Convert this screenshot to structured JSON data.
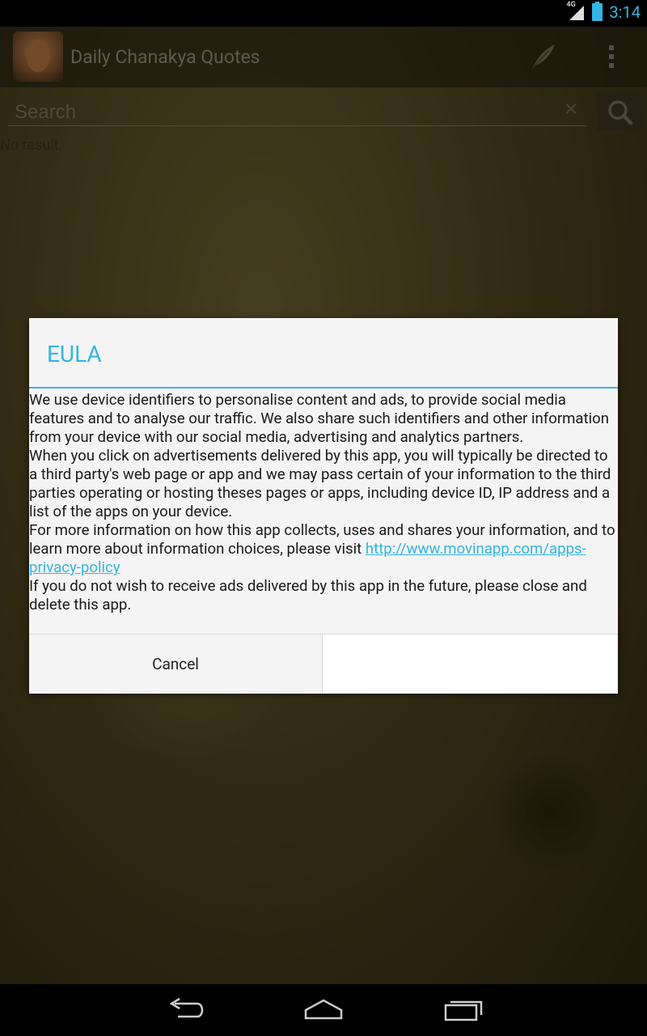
{
  "status_bar": {
    "network": "4G",
    "time": "3:14"
  },
  "app_bar": {
    "title": "Daily Chanakya Quotes",
    "icons": [
      "app-logo-icon",
      "feather-icon",
      "overflow-menu-icon"
    ]
  },
  "search": {
    "placeholder": "Search",
    "value": ""
  },
  "results": {
    "empty_text": "No result."
  },
  "dialog": {
    "title": "EULA",
    "para1": "We use device identifiers to personalise content and ads, to provide social media features and to analyse our traffic. We also share such identifiers and other information from your device with our social media, advertising and analytics partners.",
    "para2": "When you click on advertisements delivered by this app, you will typically be directed to a third party's web page or app and we may pass certain of your information to the third parties operating or hosting theses pages or apps, including device ID, IP address and a list of the apps on your device.",
    "para3_text": "For more information on how this app collects, uses and shares your information, and to learn more about information choices, please visit ",
    "para3_link": "http://www.movinapp.com/apps-privacy-policy",
    "para4": "If you do not wish to receive ads delivered by this app in the future, please close and delete this app.",
    "cancel_label": "Cancel"
  },
  "colors": {
    "accent": "#33b5e5"
  }
}
